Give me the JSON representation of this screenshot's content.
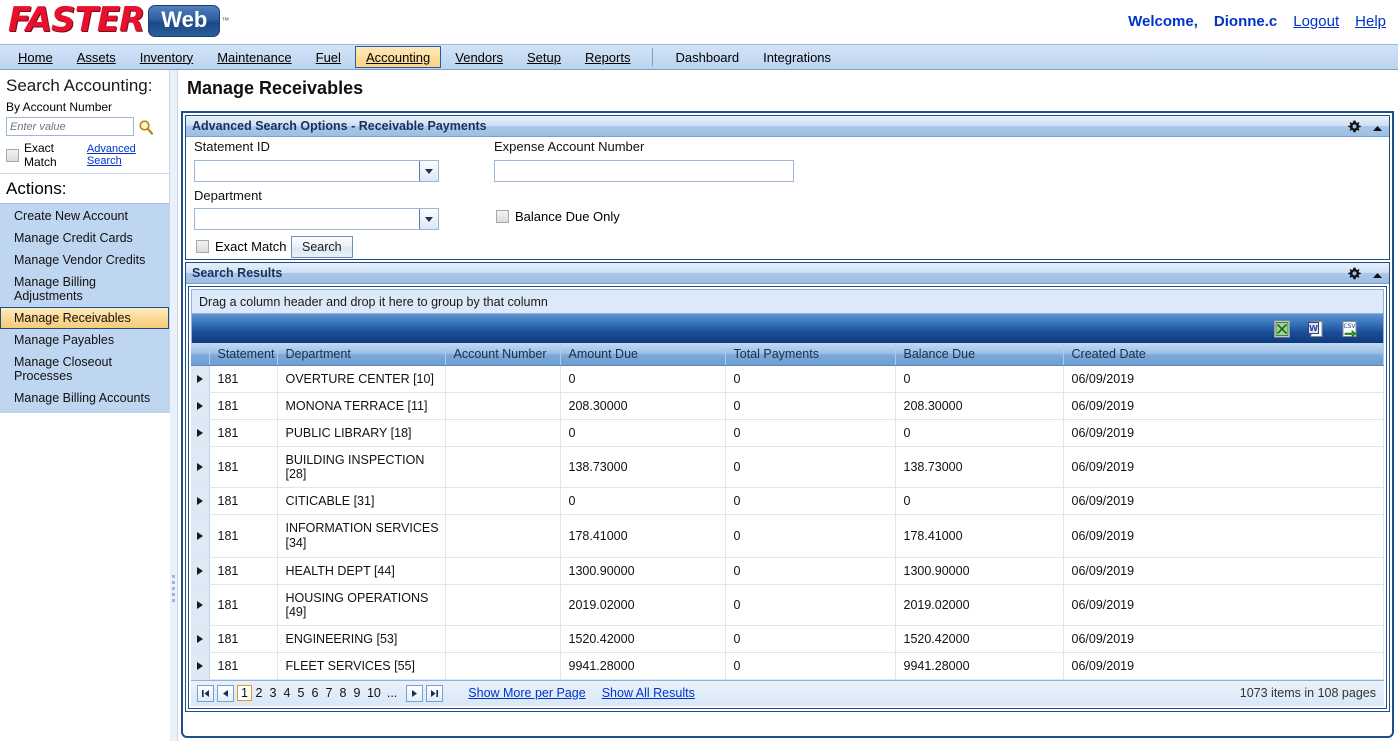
{
  "brand": {
    "name_faster": "FASTER",
    "name_web": "Web",
    "tm": "™",
    "accent_red": "#e8112d",
    "accent_blue": "#1b4a86",
    "link_blue": "#0033cc",
    "selection_orange": "#fcd894"
  },
  "header": {
    "welcome": "Welcome,",
    "username": "Dionne.c",
    "logout": "Logout",
    "help": "Help"
  },
  "nav": {
    "items": [
      {
        "label": "Home",
        "active": false
      },
      {
        "label": "Assets",
        "active": false
      },
      {
        "label": "Inventory",
        "active": false
      },
      {
        "label": "Maintenance",
        "active": false
      },
      {
        "label": "Fuel",
        "active": false
      },
      {
        "label": "Accounting",
        "active": true
      },
      {
        "label": "Vendors",
        "active": false
      },
      {
        "label": "Setup",
        "active": false
      },
      {
        "label": "Reports",
        "active": false
      },
      {
        "label": "Dashboard",
        "active": false
      },
      {
        "label": "Integrations",
        "active": false
      }
    ]
  },
  "sidebar": {
    "search_title": "Search Accounting:",
    "search_by": "By Account Number",
    "search_placeholder": "Enter value",
    "search_value": "",
    "search_icon": "magnifier-icon",
    "exact_match_label": "Exact Match",
    "exact_match_checked": false,
    "advanced_search_link": "Advanced Search",
    "actions_title": "Actions:",
    "items": [
      {
        "label": "Create New Account",
        "selected": false
      },
      {
        "label": "Manage Credit Cards",
        "selected": false
      },
      {
        "label": "Manage Vendor Credits",
        "selected": false
      },
      {
        "label": "Manage Billing Adjustments",
        "selected": false
      },
      {
        "label": "Manage Receivables",
        "selected": true
      },
      {
        "label": "Manage Payables",
        "selected": false
      },
      {
        "label": "Manage Closeout Processes",
        "selected": false
      },
      {
        "label": "Manage Billing Accounts",
        "selected": false
      }
    ]
  },
  "main": {
    "page_title": "Manage Receivables",
    "advanced_search": {
      "title": "Advanced Search Options",
      "subtitle": "- Receivable Payments",
      "gear_icon": "gear-icon",
      "collapse_icon": "chevron-up-icon",
      "statement_id_label": "Statement ID",
      "statement_id_value": "",
      "department_label": "Department",
      "department_value": "",
      "expense_account_label": "Expense Account Number",
      "expense_account_value": "",
      "balance_due_only_label": "Balance Due Only",
      "balance_due_only_checked": false,
      "exact_match_label": "Exact Match",
      "exact_match_checked": false,
      "search_button": "Search"
    },
    "search_results": {
      "title": "Search Results",
      "gear_icon": "gear-icon",
      "collapse_icon": "chevron-up-icon",
      "group_hint": "Drag a column header and drop it here to group by that column",
      "export_icons": [
        {
          "name": "export-excel-icon",
          "label": "Export to Excel"
        },
        {
          "name": "export-word-icon",
          "label": "Export to Word"
        },
        {
          "name": "export-csv-icon",
          "label": "Export to CSV"
        }
      ],
      "columns": [
        "Statement",
        "Department",
        "Account Number",
        "Amount Due",
        "Total Payments",
        "Balance Due",
        "Created Date"
      ],
      "rows": [
        {
          "statement": "181",
          "department": "OVERTURE CENTER [10]",
          "account_number": "",
          "amount_due": "0",
          "total_payments": "0",
          "balance_due": "0",
          "created_date": "06/09/2019"
        },
        {
          "statement": "181",
          "department": "MONONA TERRACE [11]",
          "account_number": "",
          "amount_due": "208.30000",
          "total_payments": "0",
          "balance_due": "208.30000",
          "created_date": "06/09/2019"
        },
        {
          "statement": "181",
          "department": "PUBLIC LIBRARY [18]",
          "account_number": "",
          "amount_due": "0",
          "total_payments": "0",
          "balance_due": "0",
          "created_date": "06/09/2019"
        },
        {
          "statement": "181",
          "department": "BUILDING INSPECTION [28]",
          "account_number": "",
          "amount_due": "138.73000",
          "total_payments": "0",
          "balance_due": "138.73000",
          "created_date": "06/09/2019"
        },
        {
          "statement": "181",
          "department": "CITICABLE [31]",
          "account_number": "",
          "amount_due": "0",
          "total_payments": "0",
          "balance_due": "0",
          "created_date": "06/09/2019"
        },
        {
          "statement": "181",
          "department": "INFORMATION SERVICES [34]",
          "account_number": "",
          "amount_due": "178.41000",
          "total_payments": "0",
          "balance_due": "178.41000",
          "created_date": "06/09/2019"
        },
        {
          "statement": "181",
          "department": "HEALTH DEPT [44]",
          "account_number": "",
          "amount_due": "1300.90000",
          "total_payments": "0",
          "balance_due": "1300.90000",
          "created_date": "06/09/2019"
        },
        {
          "statement": "181",
          "department": "HOUSING OPERATIONS [49]",
          "account_number": "",
          "amount_due": "2019.02000",
          "total_payments": "0",
          "balance_due": "2019.02000",
          "created_date": "06/09/2019"
        },
        {
          "statement": "181",
          "department": "ENGINEERING [53]",
          "account_number": "",
          "amount_due": "1520.42000",
          "total_payments": "0",
          "balance_due": "1520.42000",
          "created_date": "06/09/2019"
        },
        {
          "statement": "181",
          "department": "FLEET SERVICES [55]",
          "account_number": "",
          "amount_due": "9941.28000",
          "total_payments": "0",
          "balance_due": "9941.28000",
          "created_date": "06/09/2019"
        }
      ],
      "pager": {
        "first_icon": "first-page-icon",
        "prev_icon": "previous-page-icon",
        "next_icon": "next-page-icon",
        "last_icon": "last-page-icon",
        "pages": [
          "1",
          "2",
          "3",
          "4",
          "5",
          "6",
          "7",
          "8",
          "9",
          "10",
          "..."
        ],
        "current_page": "1",
        "show_more_link": "Show More per Page",
        "show_all_link": "Show All Results",
        "count_text": "1073 items in 108 pages"
      }
    }
  }
}
